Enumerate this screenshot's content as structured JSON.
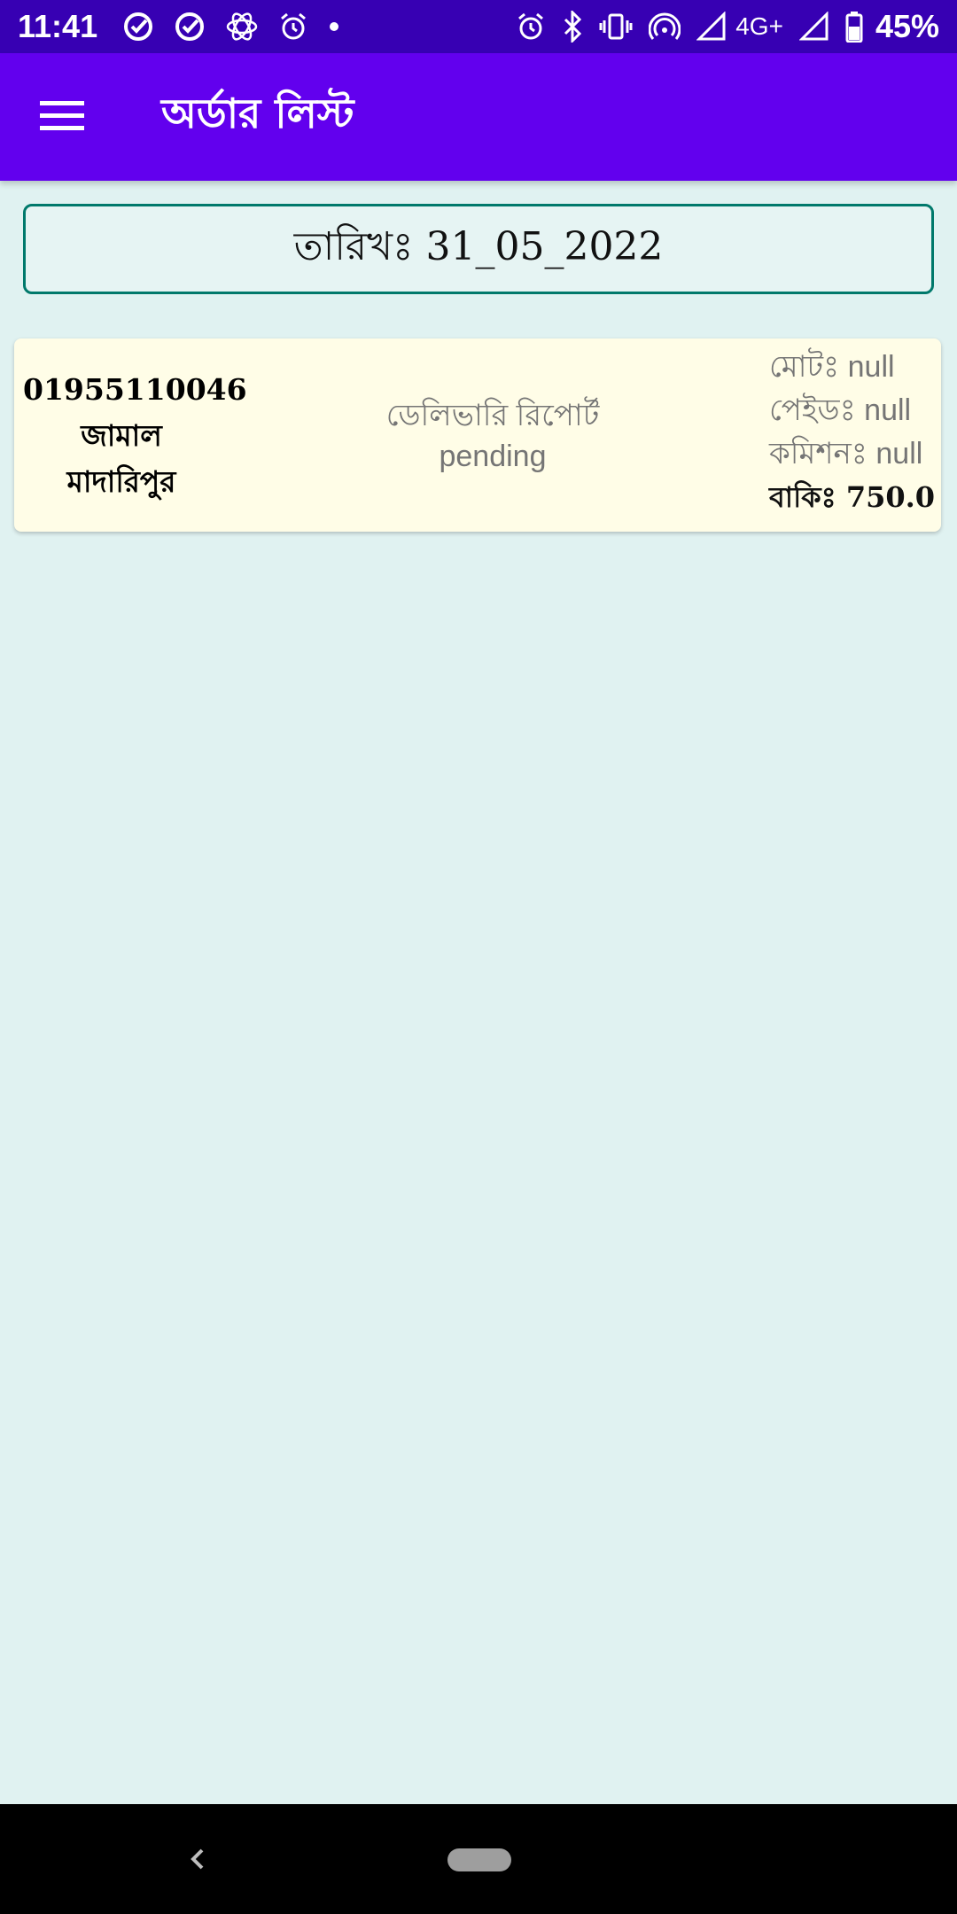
{
  "status_bar": {
    "time": "11:41",
    "left_icons": [
      "check-circle-icon",
      "check-circle-icon",
      "atom-icon",
      "alarm-icon",
      "dot-icon"
    ],
    "right_icons": [
      "alarm-icon",
      "bluetooth-icon",
      "vibrate-icon",
      "hotspot-icon",
      "signal-icon",
      "signal-icon",
      "battery-icon"
    ],
    "network": "4G+",
    "battery": "45%"
  },
  "app_bar": {
    "title": "অর্ডার লিস্ট",
    "menu_icon": "menu-icon",
    "background": "#6200EE"
  },
  "date_box": {
    "label": "তারিখঃ 31_05_2022"
  },
  "orders": [
    {
      "phone": "01955110046",
      "name": "জামাল",
      "place": "মাদারিপুর",
      "delivery_label": "ডেলিভারি রিপোর্ট",
      "delivery_status": "pending",
      "total": "মোটঃ null",
      "paid": "পেইডঃ null",
      "commission": "কমিশনঃ null",
      "due": "বাকিঃ 750.0"
    }
  ],
  "nav_bar": {
    "back_icon": "back-chevron-icon",
    "home_icon": "home-pill-icon"
  },
  "colors": {
    "status_bar": "#3700B3",
    "app_bar": "#6200EE",
    "background": "#E0F2F1",
    "card": "#FFFDE7",
    "date_border": "#00796B"
  }
}
